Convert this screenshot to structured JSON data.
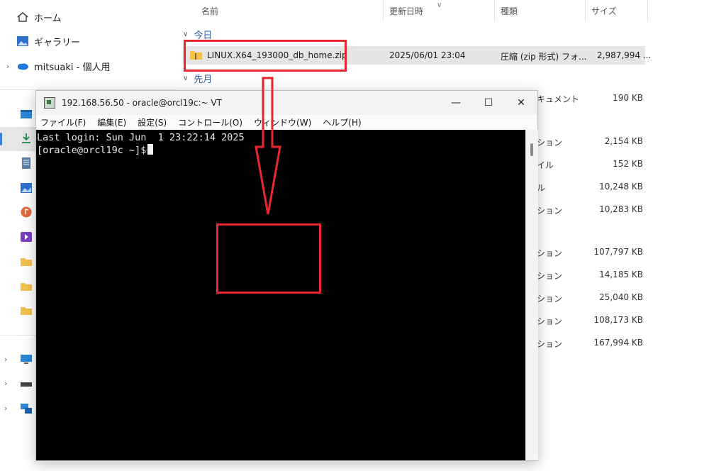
{
  "explorer": {
    "nav": {
      "home": "ホーム",
      "gallery": "ギャラリー",
      "onedrive": "mitsuaki - 個人用"
    },
    "columns": {
      "name": "名前",
      "modified": "更新日時",
      "type": "種類",
      "size": "サイズ"
    },
    "groups": {
      "today": "今日",
      "earlier_month": "先月"
    },
    "selected_file": {
      "name": "LINUX.X64_193000_db_home.zip",
      "modified": "2025/06/01 23:04",
      "type": "圧縮 (zip 形式) フォ...",
      "size": "2,987,994 ..."
    },
    "rows": [
      {
        "type": "キュメント",
        "size": "190 KB"
      },
      {
        "type": "ション",
        "size": "2,154 KB"
      },
      {
        "type": "イル",
        "size": "152 KB"
      },
      {
        "type": "ル",
        "size": "10,248 KB"
      },
      {
        "type": "ション",
        "size": "10,283 KB"
      },
      {
        "type": "ション",
        "size": "107,797 KB"
      },
      {
        "type": "ション",
        "size": "14,185 KB"
      },
      {
        "type": "ション",
        "size": "25,040 KB"
      },
      {
        "type": "ション",
        "size": "108,173 KB"
      },
      {
        "type": "ション",
        "size": "167,994 KB"
      }
    ]
  },
  "terminal": {
    "title": "192.168.56.50 - oracle@orcl19c:~ VT",
    "menu": [
      "ファイル(F)",
      "編集(E)",
      "設定(S)",
      "コントロール(O)",
      "ウィンドウ(W)",
      "ヘルプ(H)"
    ],
    "lines": [
      "Last login: Sun Jun  1 23:22:14 2025",
      "[oracle@orcl19c ~]$"
    ],
    "buttons": {
      "minimize": "—",
      "maximize": "☐",
      "close": "✕"
    }
  },
  "colors": {
    "annotation_red": "#e8262f",
    "console_bg": "#000000",
    "selection_bg": "#e5e5e5"
  }
}
